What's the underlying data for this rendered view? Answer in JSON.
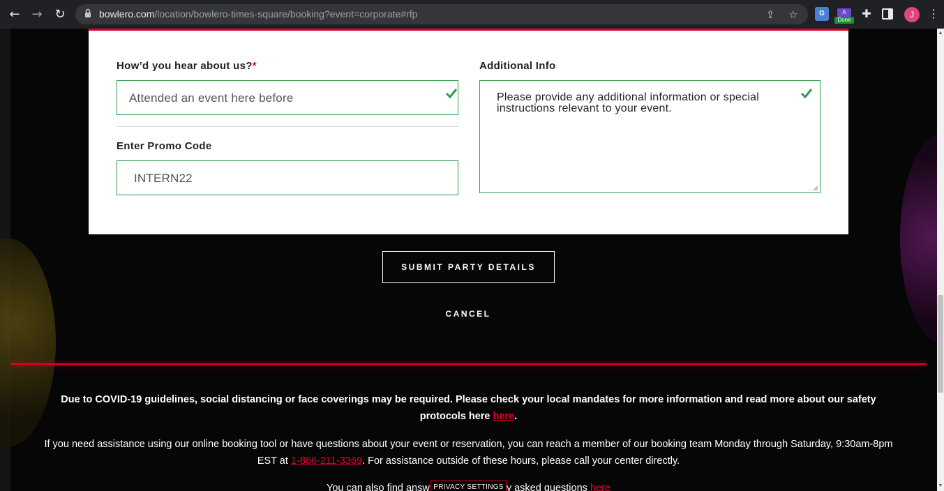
{
  "browser": {
    "url_host": "bowlero.com",
    "url_path": "/location/bowlero-times-square/booking?event=corporate#rfp",
    "avatar_letter": "J",
    "extension_badge": "Done",
    "extension_a": "A"
  },
  "form": {
    "hear_label": "How’d you hear about us?",
    "hear_required": "*",
    "hear_value": "Attended an event here before",
    "promo_label": "Enter Promo Code",
    "promo_value": "INTERN22",
    "additional_label": "Additional Info",
    "additional_placeholder": "Please provide any additional information or special instructions relevant to your event."
  },
  "actions": {
    "submit_label": "SUBMIT PARTY DETAILS",
    "cancel_label": "CANCEL"
  },
  "footer": {
    "covid_text": "Due to COVID-19 guidelines, social distancing or face coverings may be required. Please check your local mandates for more information and read more about our safety protocols here",
    "covid_link": "here",
    "covid_end": ".",
    "assist_text_1": "If you need assistance using our online booking tool or have questions about your event or reservation, you can reach a member of our booking team Monday through Saturday, 9:30am-8pm EST at ",
    "assist_phone": "1-866-211-3369",
    "assist_text_2": ". For assistance outside of these hours, please call your center directly.",
    "faq_text_1": "You can also find answ",
    "faq_text_2": "y asked questions ",
    "faq_link": "here",
    "privacy_label": "PRIVACY SETTINGS"
  },
  "colors": {
    "accent_red": "#e4002b",
    "valid_green": "#2e9b4a"
  }
}
